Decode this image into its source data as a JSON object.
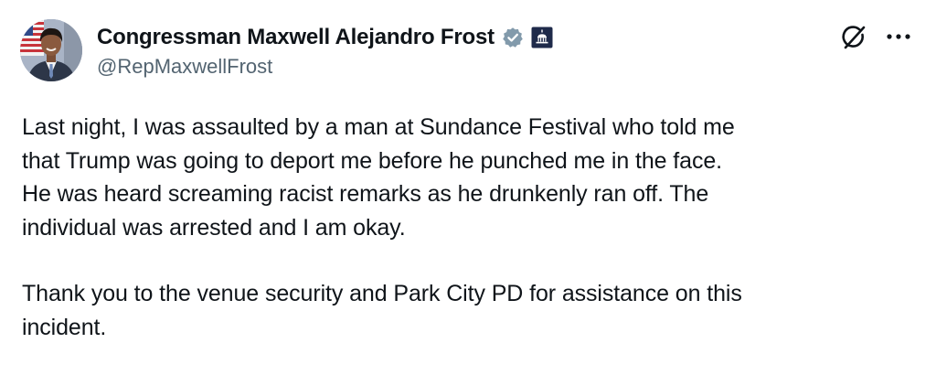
{
  "author": {
    "display_name": "Congressman Maxwell Alejandro Frost",
    "handle": "@RepMaxwellFrost",
    "verified_badge_icon": "verified-gray-icon",
    "affiliation_badge_icon": "capitol-government-icon",
    "badge_color": "#829aab"
  },
  "actions": {
    "grok_icon": "grok-icon",
    "more_icon": "more-options-icon"
  },
  "tweet": {
    "paragraphs": [
      "Last night, I was assaulted by a man at Sundance Festival who told me\nthat Trump was going to deport me before he punched me in the face.\nHe was heard screaming racist remarks as he drunkenly ran off. The\nindividual was arrested and I am okay.",
      "Thank you to the venue security and Park City PD for assistance on this\nincident."
    ]
  }
}
